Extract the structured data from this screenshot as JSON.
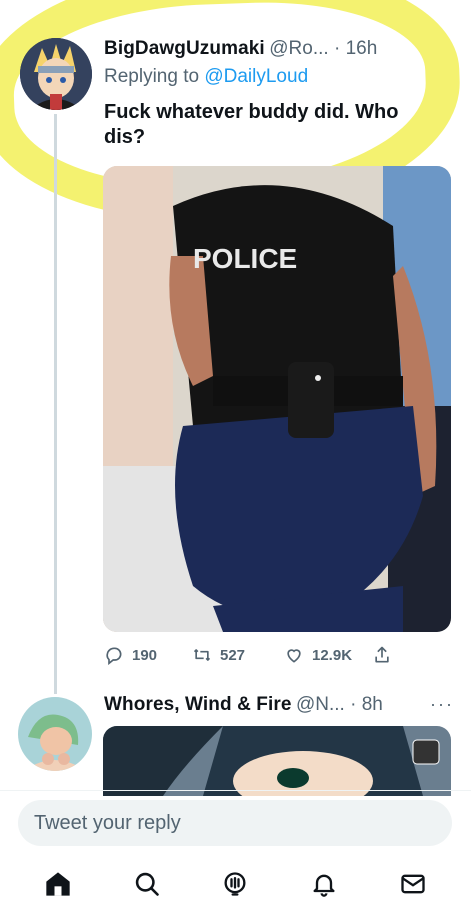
{
  "tweet1": {
    "display_name": "BigDawgUzumaki",
    "handle_time": "@Ro... · 16h",
    "reply_prefix": "Replying to",
    "reply_handle": "@DailyLoud",
    "text": "Fuck whatever buddy did. Who dis?",
    "media_caption": "POLICE",
    "actions": {
      "replies": "190",
      "retweets": "527",
      "likes": "12.9K"
    }
  },
  "tweet2": {
    "display_name": "Whores, Wind & Fire",
    "handle_time": "@N... · 8h",
    "more": "···"
  },
  "composer": {
    "placeholder": "Tweet your reply"
  },
  "bottom_nav": [
    "home-icon",
    "search-icon",
    "spaces-icon",
    "notifications-icon",
    "messages-icon"
  ],
  "colors": {
    "accent": "#1d9bf0",
    "highlight": "#f2f057",
    "muted": "#536471"
  }
}
